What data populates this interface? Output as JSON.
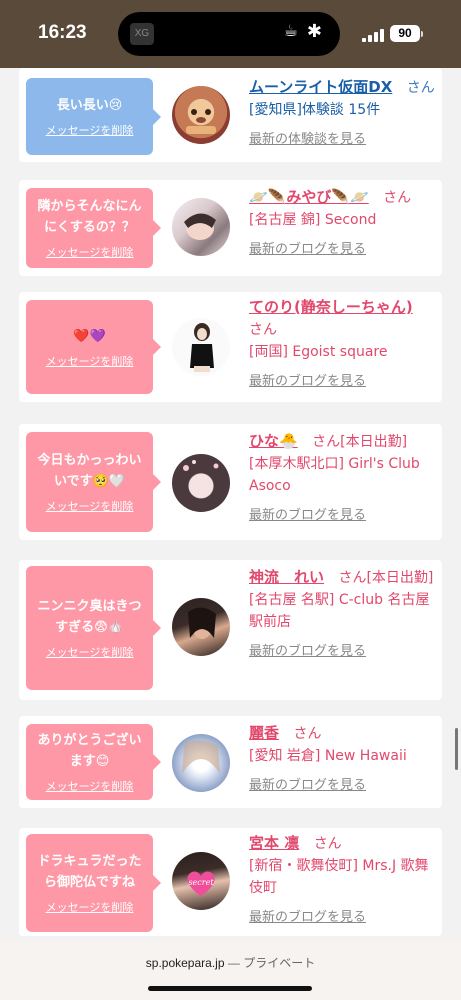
{
  "status_bar": {
    "time": "16:23",
    "battery": "90",
    "island_app": "XG"
  },
  "browser": {
    "url": "sp.pokepara.jp",
    "separator": "—",
    "mode": "プライベート"
  },
  "colors": {
    "pink_bubble": "#ff98a6",
    "blue_bubble": "#8cb8ec",
    "name_pink": "#e2486c",
    "name_blue": "#1a5fa8"
  },
  "cards": [
    {
      "message": "長い長い😢",
      "delete": "メッセージを削除",
      "name": "ムーンライト仮面DX",
      "suffix": "さん",
      "shop": "[愛知県]体験談 15件",
      "link": "最新の体験談を見る",
      "theme": "blue"
    },
    {
      "message": "隣からそんなにんにくするの？？",
      "delete": "メッセージを削除",
      "name": "🪐🪶みやび🪶🪐",
      "suffix": "さん",
      "shop": "[名古屋 錦] Second",
      "link": "最新のブログを見る",
      "theme": "pink"
    },
    {
      "message": "❤️💜",
      "delete": "メッセージを削除",
      "name": "てのり(静奈しーちゃん)",
      "suffix": "さん",
      "shop": "[両国] Egoist square",
      "link": "最新のブログを見る",
      "theme": "pink"
    },
    {
      "message": "今日もかっっわいいです🥺🤍",
      "delete": "メッセージを削除",
      "name": "ひな🐣",
      "suffix": "さん[本日出勤]",
      "shop": "[本厚木駅北口] Girl's Club Asoco",
      "link": "最新のブログを見る",
      "theme": "pink"
    },
    {
      "message": "ニンニク臭はきつすぎる😨🧄",
      "delete": "メッセージを削除",
      "name": "神流　れい",
      "suffix": "さん[本日出勤]",
      "shop": "[名古屋 名駅] C-club 名古屋駅前店",
      "link": "最新のブログを見る",
      "theme": "pink"
    },
    {
      "message": "ありがとうございます😊",
      "delete": "メッセージを削除",
      "name": "麗香",
      "suffix": "さん",
      "shop": "[愛知 岩倉] New Hawaii",
      "link": "最新のブログを見る",
      "theme": "pink"
    },
    {
      "message": "ドラキュラだったら御陀仏ですね",
      "delete": "メッセージを削除",
      "name": "宮本 凛",
      "suffix": "さん",
      "shop": "[新宿・歌舞伎町] Mrs.J 歌舞伎町",
      "link": "最新のブログを見る",
      "theme": "pink",
      "avatar_text": "secret"
    }
  ]
}
